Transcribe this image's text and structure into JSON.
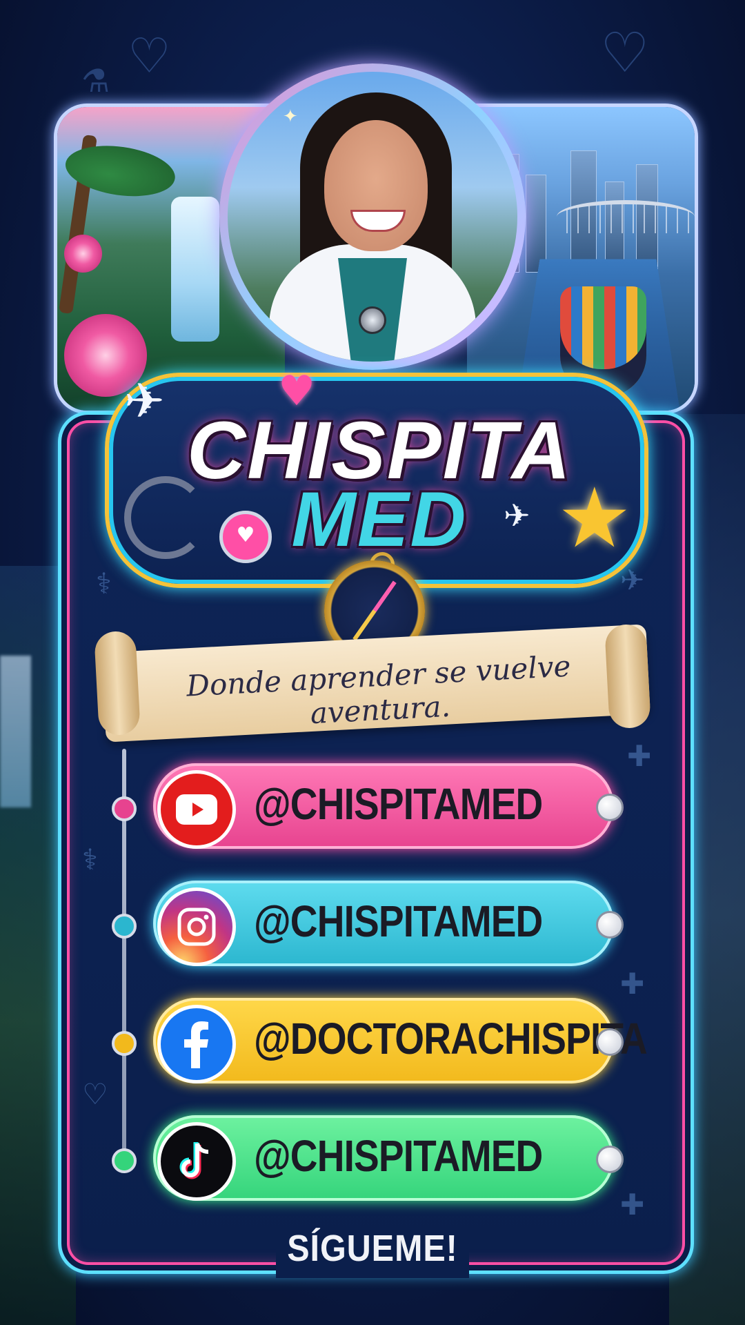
{
  "brand": {
    "name_line1": "CHISPITA",
    "name_line2": "MED",
    "tagline": "Donde aprender se vuelve aventura.",
    "accent_pink": "#ff4fa6",
    "accent_cyan": "#42d6e6",
    "accent_gold": "#f4c33a"
  },
  "socials": [
    {
      "platform": "YouTube",
      "icon": "youtube-icon",
      "handle": "@CHISPITAMED",
      "color": "#ff79b6"
    },
    {
      "platform": "Instagram",
      "icon": "instagram-icon",
      "handle": "@CHISPITAMED",
      "color": "#5fdcef"
    },
    {
      "platform": "Facebook",
      "icon": "facebook-icon",
      "handle": "@DOCTORACHISPITA",
      "color": "#ffd84a"
    },
    {
      "platform": "TikTok",
      "icon": "tiktok-icon",
      "handle": "@CHISPITAMED",
      "color": "#6ef2a0"
    }
  ],
  "footer": {
    "cta": "SÍGUEME!"
  },
  "decor_icons": [
    "heart-icon",
    "stethoscope-icon",
    "airplane-icon",
    "compass-icon",
    "star-icon",
    "medical-kit-icon"
  ]
}
